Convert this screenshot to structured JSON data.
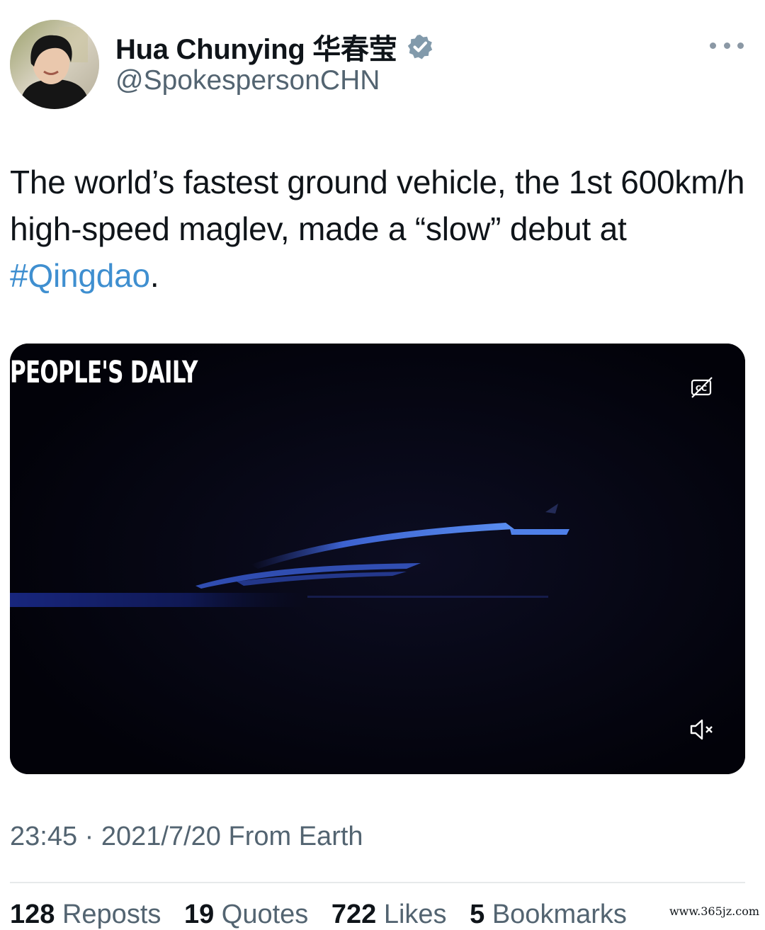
{
  "author": {
    "display_name": "Hua Chunying 华春莹",
    "handle": "@SpokespersonCHN",
    "verified": true
  },
  "tweet": {
    "text_before": "The world’s fastest ground vehicle, the 1st 600km/h high-speed maglev, made a “slow” debut at ",
    "hashtag": "#Qingdao",
    "text_after": "."
  },
  "video": {
    "watermark": "PEOPLE'S DAILY",
    "captions_icon": "closed-captions-off-icon",
    "mute_icon": "speaker-muted-icon"
  },
  "meta": {
    "time": "23:45",
    "separator": "·",
    "date": "2021/7/20",
    "source": "From Earth"
  },
  "stats": {
    "reposts_count": "128",
    "reposts_label": "Reposts",
    "quotes_count": "19",
    "quotes_label": "Quotes",
    "likes_count": "722",
    "likes_label": "Likes",
    "bookmarks_count": "5",
    "bookmarks_label": "Bookmarks"
  },
  "site_watermark": "www.365jz.com",
  "colors": {
    "hashtag": "#3f8fd0",
    "verified_badge": "#829aab",
    "secondary_text": "#536471",
    "video_background": "#03030e",
    "maglev_glow": "#3b6bd8"
  }
}
